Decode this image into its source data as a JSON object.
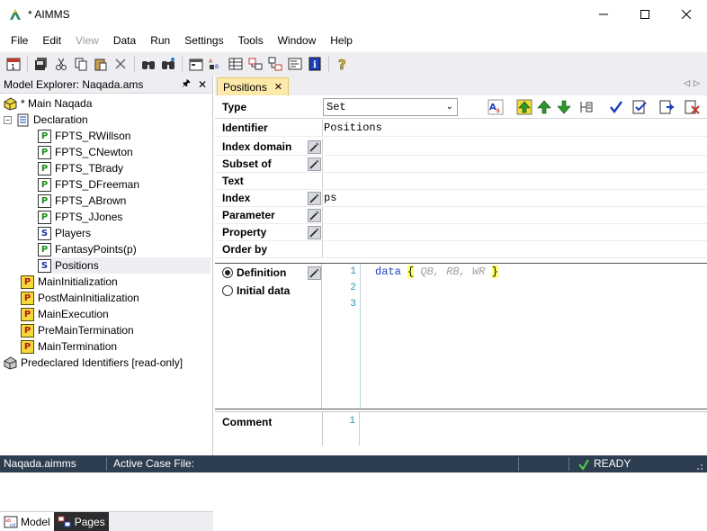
{
  "window": {
    "title": "* AIMMS"
  },
  "menu": [
    "File",
    "Edit",
    "View",
    "Data",
    "Run",
    "Settings",
    "Tools",
    "Window",
    "Help"
  ],
  "explorer": {
    "title": "Model Explorer: Naqada.ams",
    "tree": [
      {
        "label": "* Main Naqada",
        "icon": "model-icon"
      },
      {
        "label": "Declaration",
        "icon": "declaration-icon"
      },
      {
        "label": "FPTS_RWillson",
        "icon": "parameter-icon"
      },
      {
        "label": "FPTS_CNewton",
        "icon": "parameter-icon"
      },
      {
        "label": "FPTS_TBrady",
        "icon": "parameter-icon"
      },
      {
        "label": "FPTS_DFreeman",
        "icon": "parameter-icon"
      },
      {
        "label": "FPTS_ABrown",
        "icon": "parameter-icon"
      },
      {
        "label": "FPTS_JJones",
        "icon": "parameter-icon"
      },
      {
        "label": "Players",
        "icon": "set-icon"
      },
      {
        "label": "FantasyPoints(p)",
        "icon": "parameter-icon"
      },
      {
        "label": "Positions",
        "icon": "set-icon"
      },
      {
        "label": "MainInitialization",
        "icon": "procedure-icon"
      },
      {
        "label": "PostMainInitialization",
        "icon": "procedure-icon"
      },
      {
        "label": "MainExecution",
        "icon": "procedure-icon"
      },
      {
        "label": "PreMainTermination",
        "icon": "procedure-icon"
      },
      {
        "label": "MainTermination",
        "icon": "procedure-icon"
      },
      {
        "label": "Predeclared Identifiers [read-only]",
        "icon": "library-icon"
      }
    ],
    "tabs": [
      "Model",
      "Pages"
    ]
  },
  "editor": {
    "tab_label": "Positions",
    "type_label": "Type",
    "type_value": "Set",
    "attributes": [
      {
        "label": "Identifier",
        "value": "Positions",
        "wizard": false
      },
      {
        "label": "Index domain",
        "value": "",
        "wizard": true
      },
      {
        "label": "Subset of",
        "value": "",
        "wizard": true
      },
      {
        "label": "Text",
        "value": "",
        "wizard": false
      },
      {
        "label": "Index",
        "value": "ps",
        "wizard": true
      },
      {
        "label": "Parameter",
        "value": "",
        "wizard": true
      },
      {
        "label": "Property",
        "value": "",
        "wizard": true
      },
      {
        "label": "Order by",
        "value": "",
        "wizard": false
      }
    ],
    "definition_label": "Definition",
    "initial_data_label": "Initial data",
    "code": {
      "keyword": "data",
      "open": "{",
      "items": "QB, RB, WR",
      "close": "}",
      "line_numbers": [
        "1",
        "2",
        "3"
      ]
    },
    "comment_label": "Comment",
    "comment_line_numbers": [
      "1"
    ]
  },
  "status": {
    "file": "Naqada.aimms",
    "active_case": "Active Case File:",
    "state": "READY"
  }
}
